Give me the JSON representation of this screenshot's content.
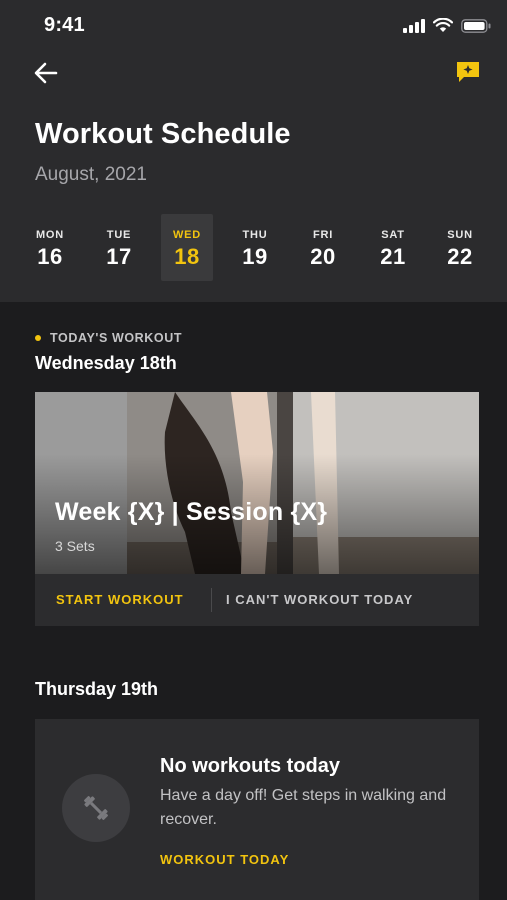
{
  "status_bar": {
    "time": "9:41"
  },
  "header": {
    "title": "Workout Schedule",
    "subtitle": "August, 2021"
  },
  "week": [
    {
      "name": "MON",
      "num": "16",
      "selected": false
    },
    {
      "name": "TUE",
      "num": "17",
      "selected": false
    },
    {
      "name": "WED",
      "num": "18",
      "selected": true
    },
    {
      "name": "THU",
      "num": "19",
      "selected": false
    },
    {
      "name": "FRI",
      "num": "20",
      "selected": false
    },
    {
      "name": "SAT",
      "num": "21",
      "selected": false
    },
    {
      "name": "SUN",
      "num": "22",
      "selected": false
    }
  ],
  "today": {
    "label": "TODAY'S WORKOUT",
    "day_heading": "Wednesday 18th",
    "card": {
      "title": "Week {X} | Session {X}",
      "subtitle": "3 Sets",
      "start_label": "START WORKOUT",
      "skip_label": "I CAN'T WORKOUT TODAY"
    }
  },
  "next": {
    "day_heading": "Thursday 19th",
    "title": "No workouts today",
    "body": "Have a day off! Get steps in walking and recover.",
    "action_label": "WORKOUT TODAY"
  },
  "colors": {
    "accent": "#f2c40f",
    "background": "#1c1c1e",
    "panel": "#2b2b2d",
    "card": "#2c2c2e"
  },
  "icons": {
    "back": "arrow-left-icon",
    "new_message": "sparkle-message-icon",
    "rest": "dumbbell-icon"
  }
}
